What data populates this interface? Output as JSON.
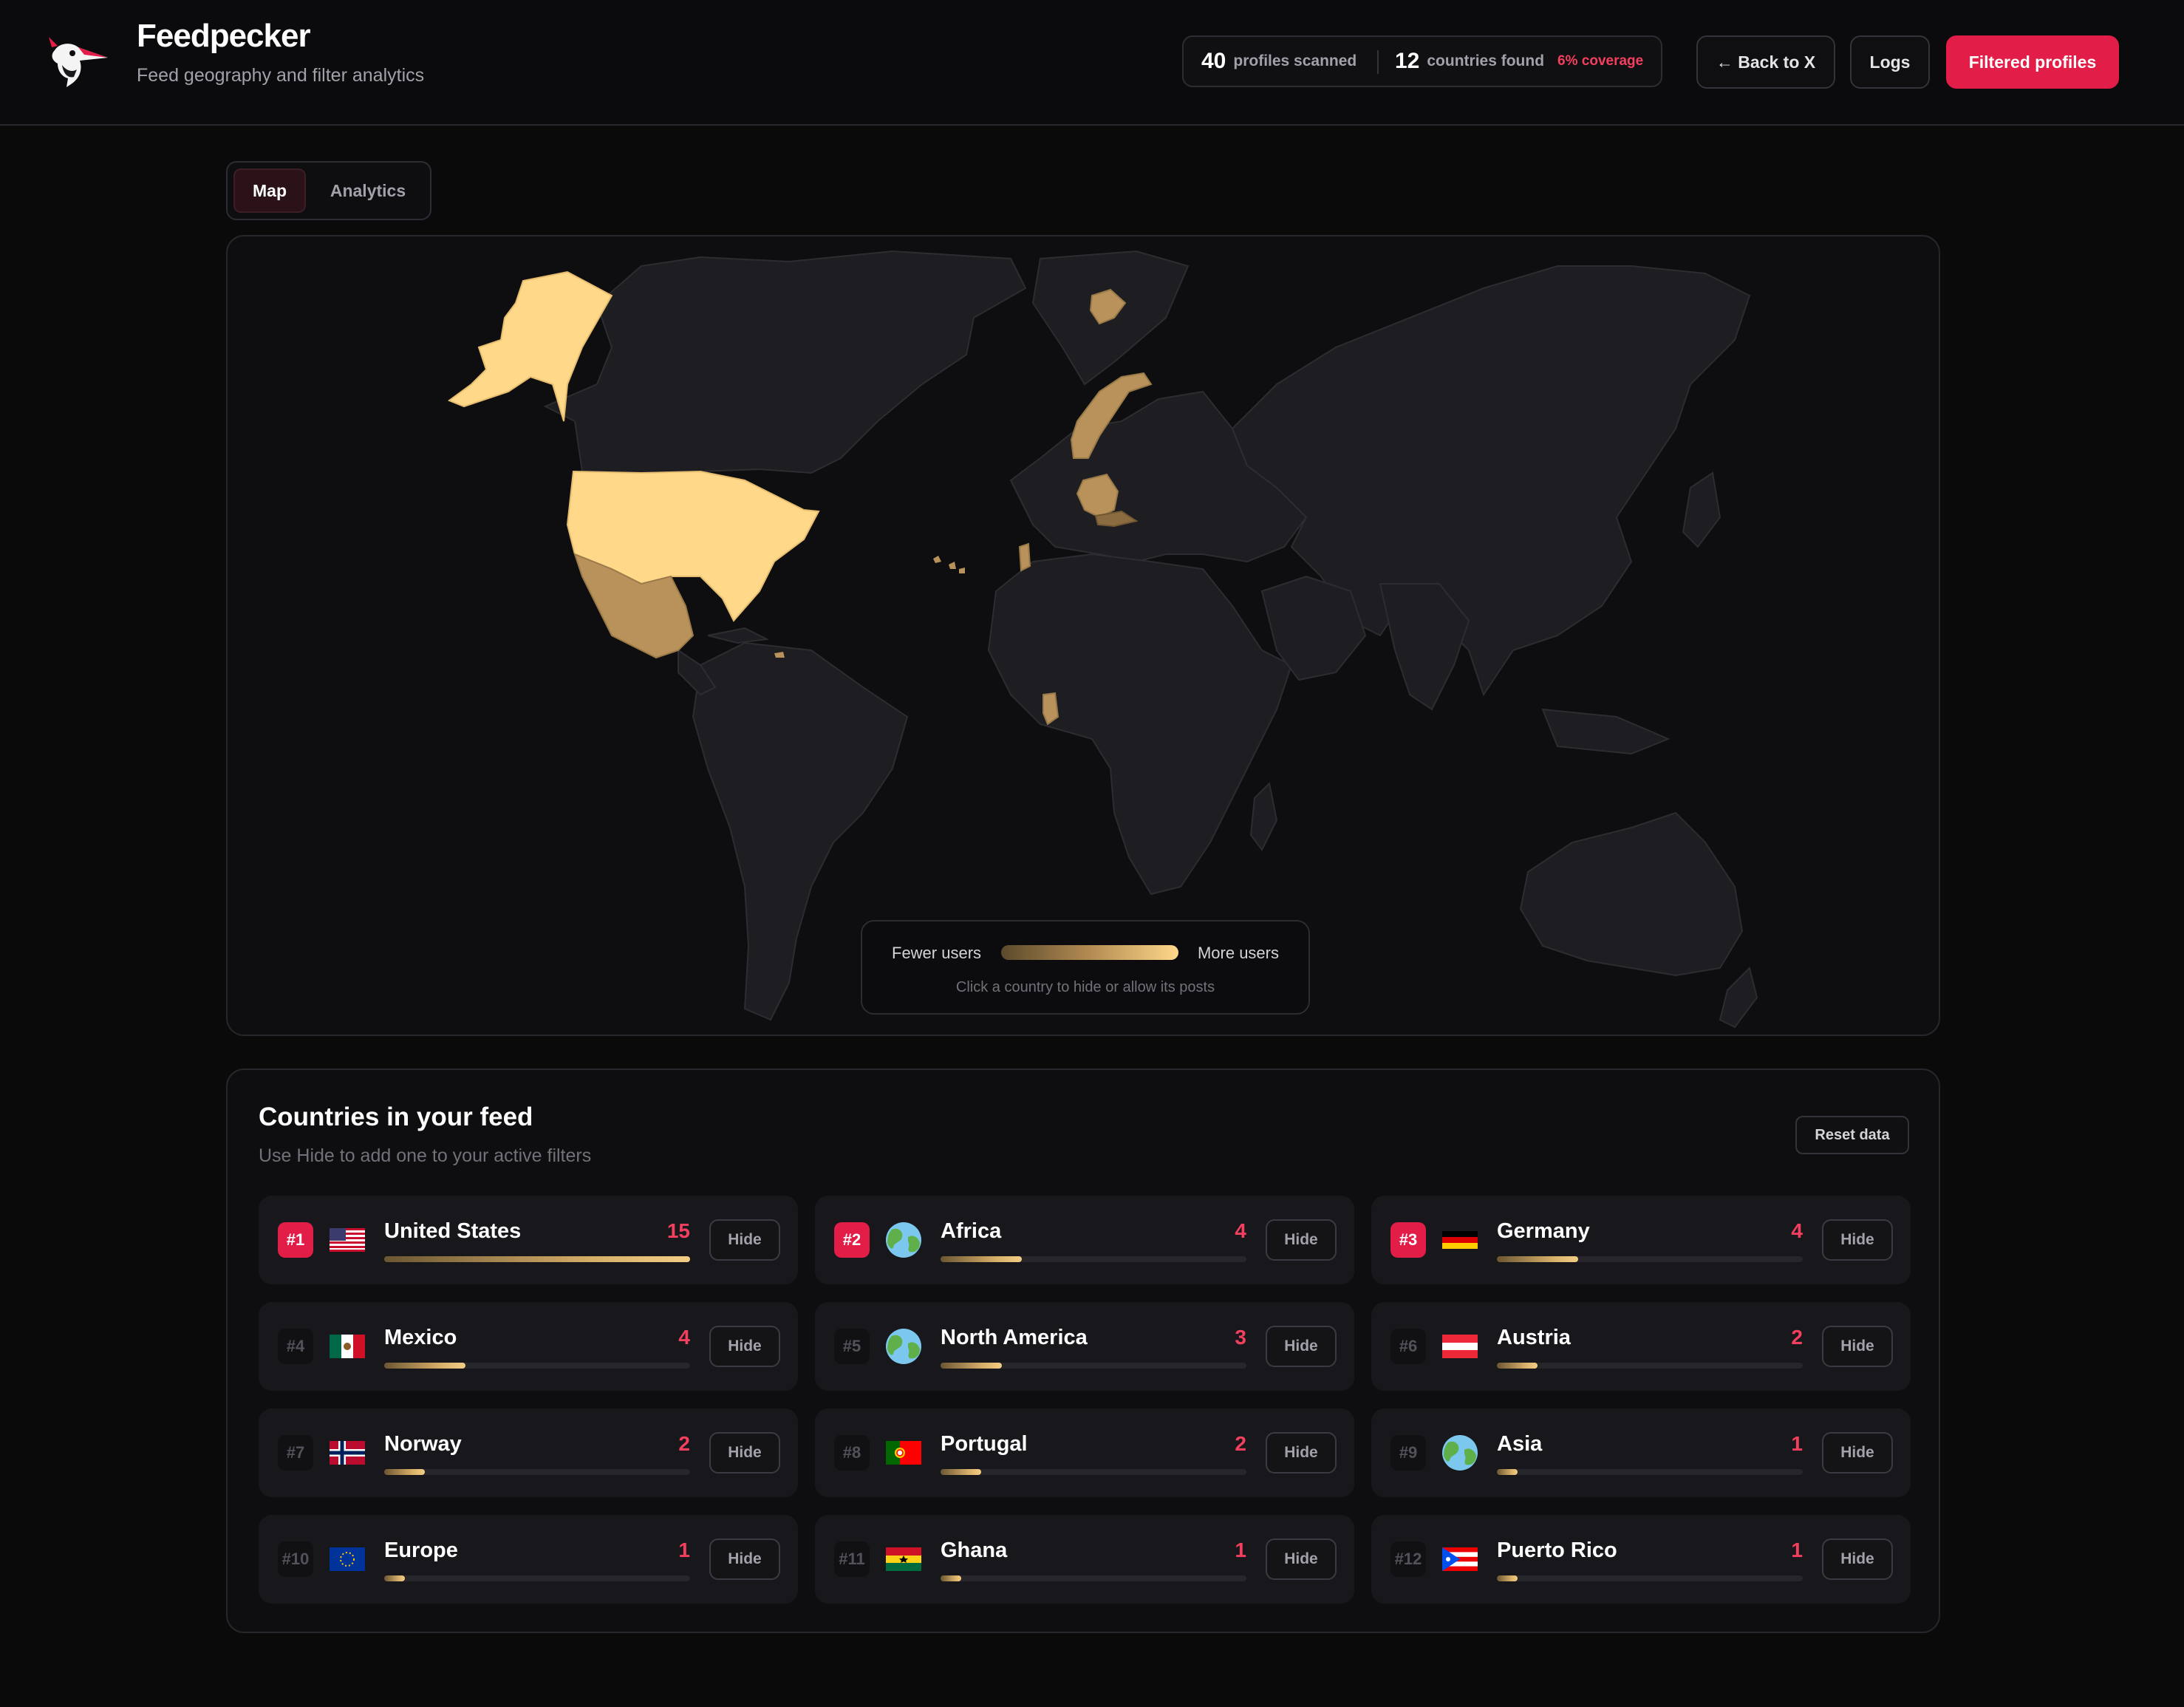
{
  "app": {
    "title": "Feedpecker",
    "subtitle": "Feed geography and filter analytics"
  },
  "stats": {
    "profiles_count": "40",
    "profiles_label": "profiles scanned",
    "countries_count": "12",
    "countries_label": "countries found",
    "coverage": "6% coverage"
  },
  "header_buttons": {
    "back": "← Back to X",
    "logs": "Logs",
    "filtered": "Filtered profiles"
  },
  "tabs": [
    {
      "label": "Map",
      "active": true
    },
    {
      "label": "Analytics",
      "active": false
    }
  ],
  "map": {
    "legend_low": "Fewer users",
    "legend_high": "More users",
    "hint": "Click a country to hide or allow its posts",
    "colors": {
      "high": "#ffd88a",
      "mid": "#c9a067",
      "low": "#8a6c40",
      "land": "#1e1e22",
      "border": "#2c2c31"
    }
  },
  "countries_panel": {
    "title": "Countries in your feed",
    "subtitle": "Use Hide to add one to your active filters",
    "reset_label": "Reset data",
    "hide_label": "Hide",
    "max_count": 15,
    "items": [
      {
        "rank": "#1",
        "name": "United States",
        "count": 15,
        "flag": "us-flag"
      },
      {
        "rank": "#2",
        "name": "Africa",
        "count": 4,
        "flag": "globe-icon"
      },
      {
        "rank": "#3",
        "name": "Germany",
        "count": 4,
        "flag": "de-flag"
      },
      {
        "rank": "#4",
        "name": "Mexico",
        "count": 4,
        "flag": "mx-flag"
      },
      {
        "rank": "#5",
        "name": "North America",
        "count": 3,
        "flag": "globe-icon"
      },
      {
        "rank": "#6",
        "name": "Austria",
        "count": 2,
        "flag": "at-flag"
      },
      {
        "rank": "#7",
        "name": "Norway",
        "count": 2,
        "flag": "no-flag"
      },
      {
        "rank": "#8",
        "name": "Portugal",
        "count": 2,
        "flag": "pt-flag"
      },
      {
        "rank": "#9",
        "name": "Asia",
        "count": 1,
        "flag": "globe-icon"
      },
      {
        "rank": "#10",
        "name": "Europe",
        "count": 1,
        "flag": "eu-flag"
      },
      {
        "rank": "#11",
        "name": "Ghana",
        "count": 1,
        "flag": "gh-flag"
      },
      {
        "rank": "#12",
        "name": "Puerto Rico",
        "count": 1,
        "flag": "pr-flag"
      }
    ]
  }
}
